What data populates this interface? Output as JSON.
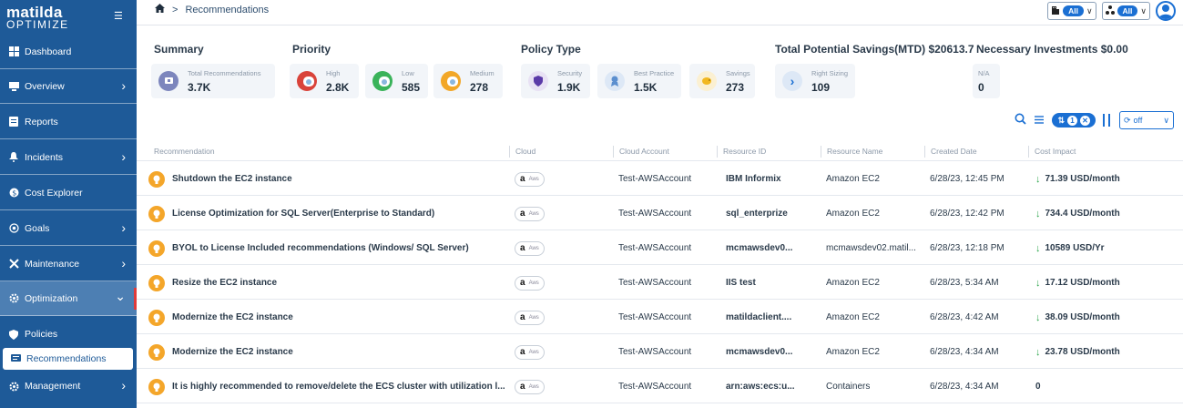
{
  "brand": {
    "line1": "matilda",
    "line2": "OPTIMIZE"
  },
  "sidebar": {
    "items": [
      {
        "label": "Dashboard",
        "icon": "dashboard-icon",
        "chevron": false
      },
      {
        "label": "Overview",
        "icon": "overview-icon",
        "chevron": true
      },
      {
        "label": "Reports",
        "icon": "reports-icon",
        "chevron": false
      },
      {
        "label": "Incidents",
        "icon": "incidents-icon",
        "chevron": true
      },
      {
        "label": "Cost Explorer",
        "icon": "cost-explorer-icon",
        "chevron": false
      },
      {
        "label": "Goals",
        "icon": "goals-icon",
        "chevron": true
      },
      {
        "label": "Maintenance",
        "icon": "maintenance-icon",
        "chevron": true
      },
      {
        "label": "Optimization",
        "icon": "optimization-icon",
        "chevron": true
      },
      {
        "label": "Policies",
        "icon": "policies-icon",
        "chevron": false
      },
      {
        "label": "Recommendations",
        "icon": "recommendations-icon",
        "chevron": false
      },
      {
        "label": "Management",
        "icon": "management-icon",
        "chevron": true
      }
    ]
  },
  "breadcrumb": {
    "current": "Recommendations"
  },
  "filters": {
    "org_value": "All",
    "group_value": "All"
  },
  "summary": {
    "sections": {
      "summary": "Summary",
      "priority": "Priority",
      "policy_type": "Policy Type",
      "savings": "Total Potential Savings(MTD) $20613.7",
      "investments": "Necessary Investments $0.00"
    },
    "cards": {
      "total": {
        "label": "Total Recommendations",
        "value": "3.7K"
      },
      "high": {
        "label": "High",
        "value": "2.8K"
      },
      "low": {
        "label": "Low",
        "value": "585"
      },
      "medium": {
        "label": "Medium",
        "value": "278"
      },
      "security": {
        "label": "Security",
        "value": "1.9K"
      },
      "best_practice": {
        "label": "Best Practice",
        "value": "1.5K"
      },
      "savings": {
        "label": "Savings",
        "value": "273"
      },
      "right_sizing": {
        "label": "Right Sizing",
        "value": "109"
      },
      "na": {
        "label": "N/A",
        "value": "0"
      }
    }
  },
  "toolbar": {
    "filter_count": "1",
    "refresh_label": "off"
  },
  "colors": {
    "sidebar": "#1e5a98",
    "accent": "#1a6fd3",
    "high": "#d9433a",
    "low": "#3ab35a",
    "medium": "#f2a728",
    "down_arrow": "#2aa54a"
  },
  "table": {
    "columns": [
      "Recommendation",
      "Cloud",
      "Cloud Account",
      "Resource ID",
      "Resource Name",
      "Created Date",
      "Cost Impact"
    ],
    "rows": [
      {
        "recommendation": "Shutdown the EC2 instance",
        "cloud": "Aws",
        "account": "Test-AWSAccount",
        "resource_id": "IBM Informix",
        "resource_name": "Amazon EC2",
        "created": "6/28/23, 12:45 PM",
        "cost": "71.39 USD/month",
        "arrow": true
      },
      {
        "recommendation": "License Optimization for SQL Server(Enterprise to Standard)",
        "cloud": "Aws",
        "account": "Test-AWSAccount",
        "resource_id": "sql_enterprize",
        "resource_name": "Amazon EC2",
        "created": "6/28/23, 12:42 PM",
        "cost": "734.4 USD/month",
        "arrow": true
      },
      {
        "recommendation": "BYOL to License Included recommendations (Windows/ SQL Server)",
        "cloud": "Aws",
        "account": "Test-AWSAccount",
        "resource_id": "mcmawsdev0...",
        "resource_name": "mcmawsdev02.matil...",
        "created": "6/28/23, 12:18 PM",
        "cost": "10589 USD/Yr",
        "arrow": true
      },
      {
        "recommendation": "Resize the EC2 instance",
        "cloud": "Aws",
        "account": "Test-AWSAccount",
        "resource_id": "IIS test",
        "resource_name": "Amazon EC2",
        "created": "6/28/23, 5:34 AM",
        "cost": "17.12 USD/month",
        "arrow": true
      },
      {
        "recommendation": "Modernize the EC2 instance",
        "cloud": "Aws",
        "account": "Test-AWSAccount",
        "resource_id": "matildaclient....",
        "resource_name": "Amazon EC2",
        "created": "6/28/23, 4:42 AM",
        "cost": "38.09 USD/month",
        "arrow": true
      },
      {
        "recommendation": "Modernize the EC2 instance",
        "cloud": "Aws",
        "account": "Test-AWSAccount",
        "resource_id": "mcmawsdev0...",
        "resource_name": "Amazon EC2",
        "created": "6/28/23, 4:34 AM",
        "cost": "23.78 USD/month",
        "arrow": true
      },
      {
        "recommendation": "It is highly recommended to remove/delete the ECS cluster with utilization l...",
        "cloud": "Aws",
        "account": "Test-AWSAccount",
        "resource_id": "arn:aws:ecs:u...",
        "resource_name": "Containers",
        "created": "6/28/23, 4:34 AM",
        "cost": "0",
        "arrow": false
      }
    ]
  }
}
